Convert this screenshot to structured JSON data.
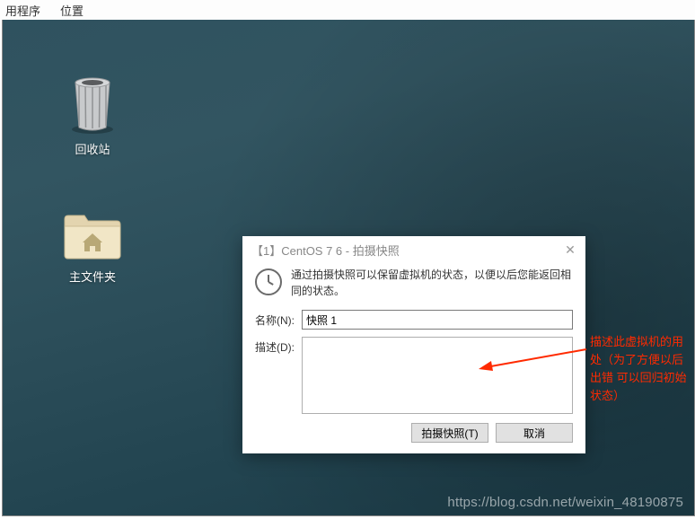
{
  "menubar": {
    "menu1": "用程序",
    "menu2": "位置"
  },
  "desktop": {
    "trash_label": "回收站",
    "home_label": "主文件夹"
  },
  "dialog": {
    "title": "【1】CentOS 7 6 - 拍摄快照",
    "info_text": "通过拍摄快照可以保留虚拟机的状态，以便以后您能返回相同的状态。",
    "name_label": "名称(N):",
    "name_value": "快照 1",
    "desc_label": "描述(D):",
    "desc_value": "",
    "take_button": "拍摄快照(T)",
    "cancel_button": "取消"
  },
  "annotation": "描述此虚拟机的用处（为了方便以后出错  可以回归初始状态）",
  "watermark": "https://blog.csdn.net/weixin_48190875"
}
